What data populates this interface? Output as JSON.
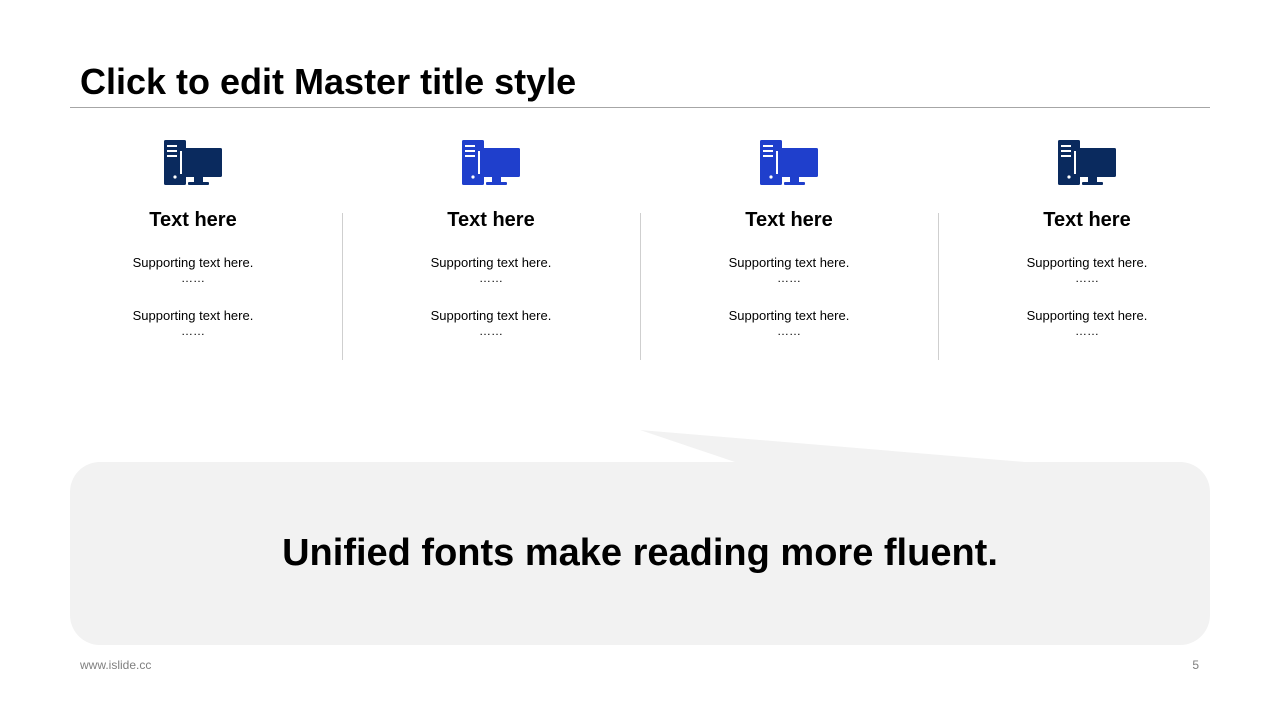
{
  "slide": {
    "title": "Click to edit Master title style"
  },
  "columns": [
    {
      "icon": "desktop-computer-icon",
      "icon_color": "#0a2a5e",
      "heading": "Text here",
      "support1": "Supporting  text here.",
      "dots1": "……",
      "support2": "Supporting  text here.",
      "dots2": "……"
    },
    {
      "icon": "desktop-computer-icon",
      "icon_color": "#1f3fcc",
      "heading": "Text here",
      "support1": "Supporting  text here.",
      "dots1": "……",
      "support2": "Supporting  text here.",
      "dots2": "……"
    },
    {
      "icon": "desktop-computer-icon",
      "icon_color": "#1f3fcc",
      "heading": "Text here",
      "support1": "Supporting  text here.",
      "dots1": "……",
      "support2": "Supporting  text here.",
      "dots2": "……"
    },
    {
      "icon": "desktop-computer-icon",
      "icon_color": "#0a2a5e",
      "heading": "Text here",
      "support1": "Supporting  text here.",
      "dots1": "……",
      "support2": "Supporting  text here.",
      "dots2": "……"
    }
  ],
  "callout": {
    "text": "Unified fonts make reading more fluent.",
    "fill_color": "#f2f2f2"
  },
  "footer": {
    "url": "www.islide.cc",
    "page_number": "5"
  }
}
